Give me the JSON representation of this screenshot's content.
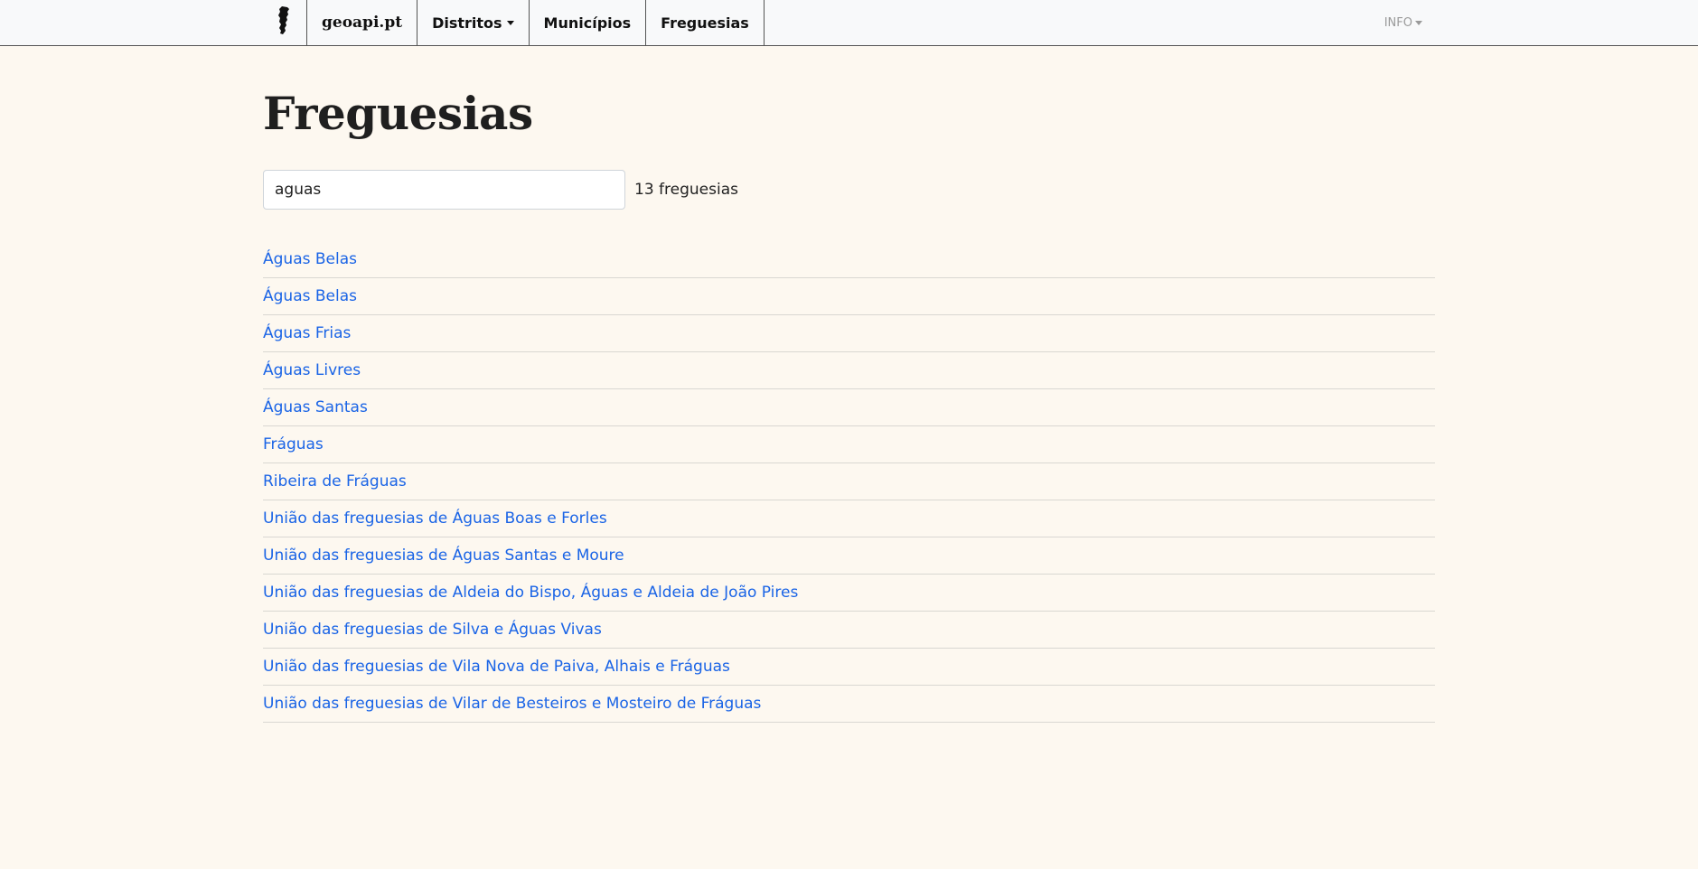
{
  "navbar": {
    "logo_icon": "portugal-map-icon",
    "brand": "geoapi.pt",
    "items": [
      {
        "label": "Distritos",
        "has_dropdown": true
      },
      {
        "label": "Municípios",
        "has_dropdown": false
      },
      {
        "label": "Freguesias",
        "has_dropdown": false
      }
    ],
    "info_label": "INFO"
  },
  "page": {
    "title": "Freguesias"
  },
  "search": {
    "value": "aguas",
    "count_text": "13 freguesias"
  },
  "results": [
    "Águas Belas",
    "Águas Belas",
    "Águas Frias",
    "Águas Livres",
    "Águas Santas",
    "Fráguas",
    "Ribeira de Fráguas",
    "União das freguesias de Águas Boas e Forles",
    "União das freguesias de Águas Santas e Moure",
    "União das freguesias de Aldeia do Bispo, Águas e Aldeia de João Pires",
    "União das freguesias de Silva e Águas Vivas",
    "União das freguesias de Vila Nova de Paiva, Alhais e Fráguas",
    "União das freguesias de Vilar de Besteiros e Mosteiro de Fráguas"
  ],
  "colors": {
    "background": "#fdf8f0",
    "link": "#1a64e6",
    "navbar": "#f8f9fa"
  }
}
